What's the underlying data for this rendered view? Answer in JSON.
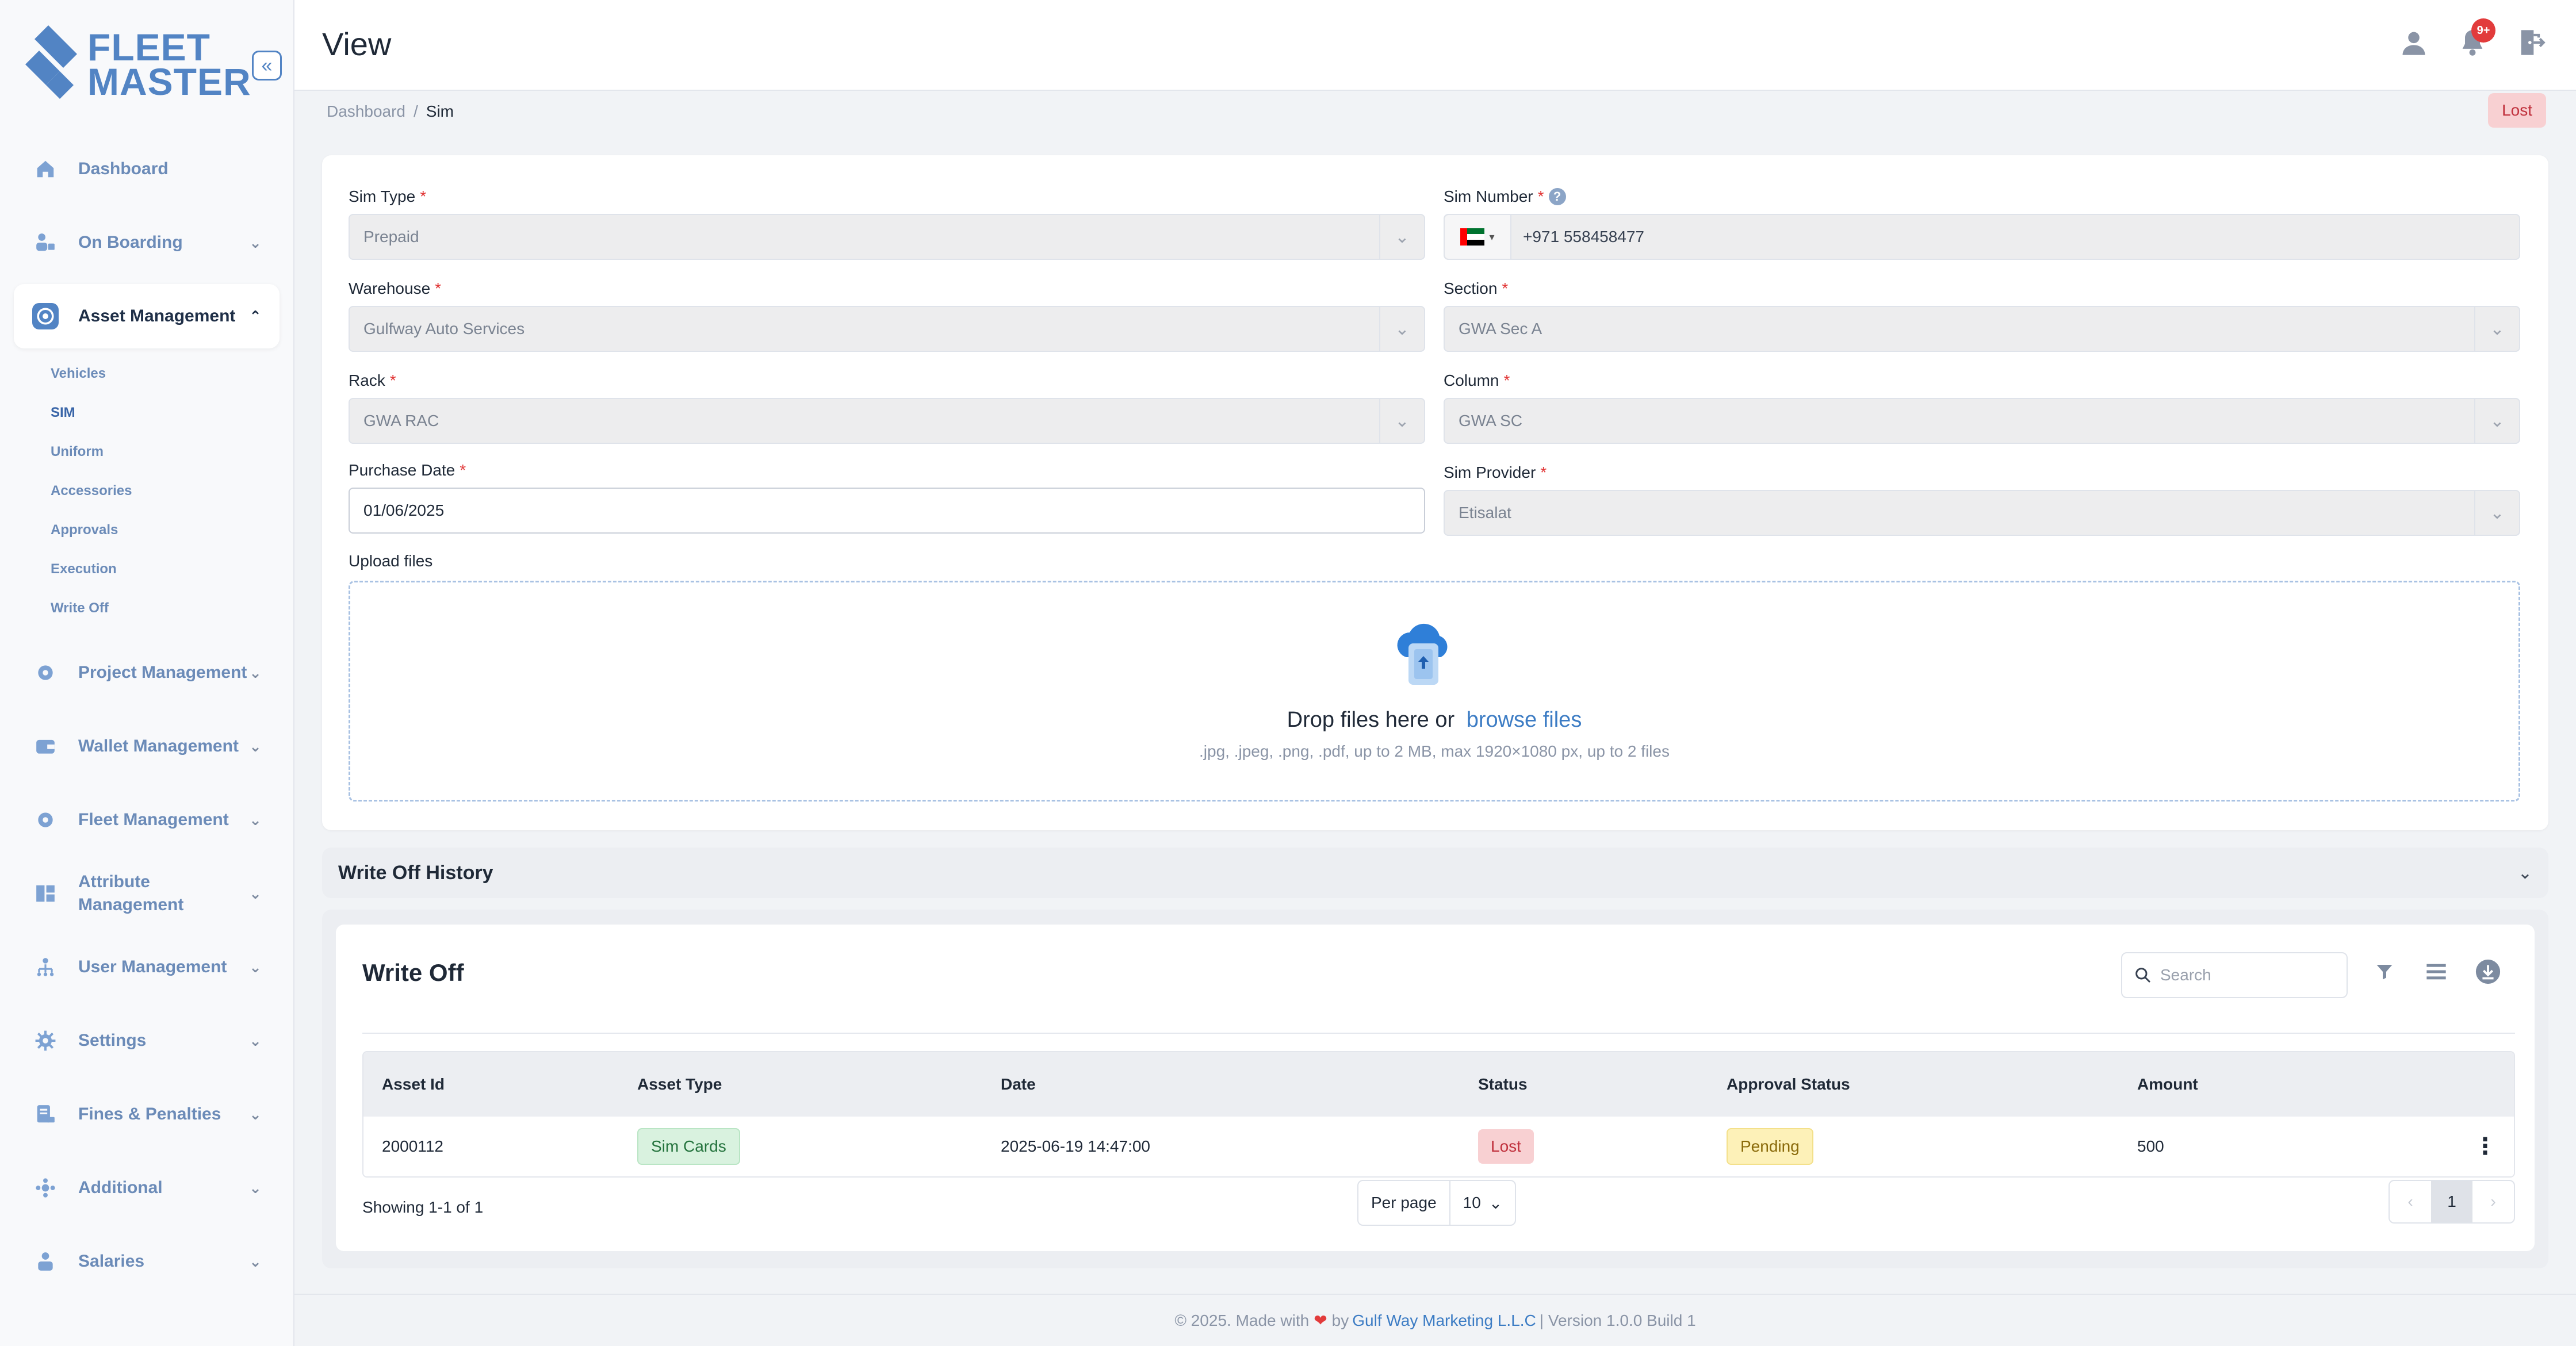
{
  "brand": {
    "line1": "FLEET",
    "line2": "MASTER",
    "accent": "#5284c4"
  },
  "sidebar": {
    "collapse_icon": "double-chevron-left-icon",
    "items": [
      {
        "label": "Dashboard",
        "icon": "home-icon",
        "has_children": false
      },
      {
        "label": "On Boarding",
        "icon": "onboarding-icon",
        "has_children": true
      },
      {
        "label": "Asset Management",
        "icon": "asset-icon",
        "has_children": true,
        "expanded": true,
        "children": [
          "Vehicles",
          "SIM",
          "Uniform",
          "Accessories",
          "Approvals",
          "Execution",
          "Write Off"
        ],
        "active_child": "SIM"
      },
      {
        "label": "Project Management",
        "icon": "project-icon",
        "has_children": true
      },
      {
        "label": "Wallet Management",
        "icon": "wallet-icon",
        "has_children": true
      },
      {
        "label": "Fleet Management",
        "icon": "fleet-icon",
        "has_children": true
      },
      {
        "label": "Attribute Management",
        "icon": "attribute-icon",
        "has_children": true
      },
      {
        "label": "User Management",
        "icon": "users-icon",
        "has_children": true
      },
      {
        "label": "Settings",
        "icon": "gear-icon",
        "has_children": true
      },
      {
        "label": "Fines & Penalties",
        "icon": "fines-icon",
        "has_children": true
      },
      {
        "label": "Additional",
        "icon": "additional-icon",
        "has_children": true
      },
      {
        "label": "Salaries",
        "icon": "salaries-icon",
        "has_children": true
      }
    ]
  },
  "header": {
    "title": "View",
    "notification_count": "9+",
    "icons": [
      "user-icon",
      "bell-icon",
      "logout-icon"
    ]
  },
  "breadcrumb": {
    "root": "Dashboard",
    "separator": "/",
    "current": "Sim"
  },
  "status_label": "Lost",
  "form": {
    "sim_type": {
      "label": "Sim Type",
      "required": "*",
      "value": "Prepaid"
    },
    "sim_number": {
      "label": "Sim Number",
      "required": "*",
      "value": "+971 558458477",
      "help": "?"
    },
    "warehouse": {
      "label": "Warehouse",
      "required": "*",
      "value": "Gulfway Auto Services"
    },
    "section": {
      "label": "Section",
      "required": "*",
      "value": "GWA Sec A"
    },
    "rack": {
      "label": "Rack",
      "required": "*",
      "value": "GWA RAC"
    },
    "column": {
      "label": "Column",
      "required": "*",
      "value": "GWA SC"
    },
    "purchase_date": {
      "label": "Purchase Date",
      "required": "*",
      "value": "01/06/2025"
    },
    "sim_provider": {
      "label": "Sim Provider",
      "required": "*",
      "value": "Etisalat"
    },
    "upload": {
      "label": "Upload files",
      "prompt": "Drop files here or",
      "link": "browse files",
      "hint": ".jpg, .jpeg, .png, .pdf, up to 2 MB, max 1920×1080 px, up to 2 files"
    }
  },
  "write_off_history": {
    "title": "Write Off History"
  },
  "table": {
    "title": "Write Off",
    "search_placeholder": "Search",
    "columns": [
      "Asset Id",
      "Asset Type",
      "Date",
      "Status",
      "Approval Status",
      "Amount"
    ],
    "rows": [
      {
        "asset_id": "2000112",
        "asset_type": "Sim Cards",
        "date": "2025-06-19 14:47:00",
        "status": "Lost",
        "approval_status": "Pending",
        "amount": "500"
      }
    ],
    "showing": "Showing 1-1 of 1",
    "per_page_label": "Per page",
    "per_page_value": "10",
    "current_page": "1"
  },
  "footer": {
    "prefix": "© 2025. Made with",
    "by": "by",
    "company": "Gulf Way Marketing L.L.C",
    "suffix": "| Version 1.0.0 Build 1"
  }
}
